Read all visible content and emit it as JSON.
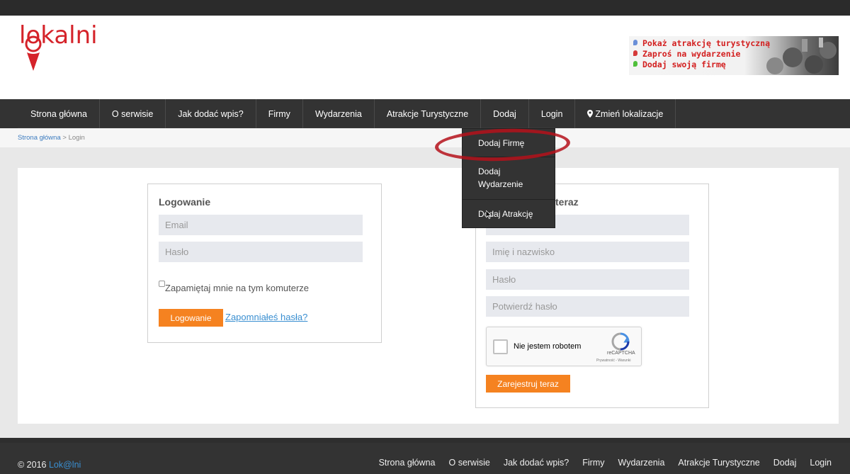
{
  "header": {
    "logo_text": "lokalni",
    "banner": {
      "lines": [
        {
          "text": "Pokaż atrakcję turystyczną",
          "dot_color": "#6a8fd8"
        },
        {
          "text": "Zaproś na wydarzenie",
          "dot_color": "#d53a3a"
        },
        {
          "text": "Dodaj swoją firmę",
          "dot_color": "#4fbf3a"
        }
      ]
    }
  },
  "nav": {
    "items": [
      "Strona główna",
      "O serwisie",
      "Jak dodać wpis?",
      "Firmy",
      "Wydarzenia",
      "Atrakcje Turystyczne",
      "Dodaj",
      "Login",
      "Zmień lokalizacje"
    ]
  },
  "dropdown": {
    "items": [
      "Dodaj Firmę",
      "Dodaj Wydarzenie",
      "Dodaj Atrakcję"
    ]
  },
  "breadcrumb": {
    "home": "Strona główna",
    "separator": " > ",
    "current": "Login"
  },
  "login": {
    "title": "Logowanie",
    "email_placeholder": "Email",
    "password_placeholder": "Hasło",
    "remember_label": "Zapamiętaj mnie na tym komuterze",
    "submit_label": "Logowanie",
    "forgot_link": "Zapomniałeś hasła?"
  },
  "register": {
    "title_visible": "teraz",
    "name_placeholder": "Imię i nazwisko",
    "password_placeholder": "Hasło",
    "confirm_placeholder": "Potwierdź hasło",
    "submit_label": "Zarejestruj teraz"
  },
  "recaptcha": {
    "label": "Nie jestem robotem",
    "brand": "reCAPTCHA",
    "terms": "Prywatność - Warunki"
  },
  "footer": {
    "copyright_prefix": "© 2016 ",
    "brand": "Lok@lni",
    "links": [
      "Strona główna",
      "O serwisie",
      "Jak dodać wpis?",
      "Firmy",
      "Wydarzenia",
      "Atrakcje Turystyczne",
      "Dodaj",
      "Login"
    ]
  },
  "colors": {
    "accent": "#f58220",
    "brand_red": "#d5232a",
    "link": "#3a8fd1",
    "dark": "#333333"
  }
}
